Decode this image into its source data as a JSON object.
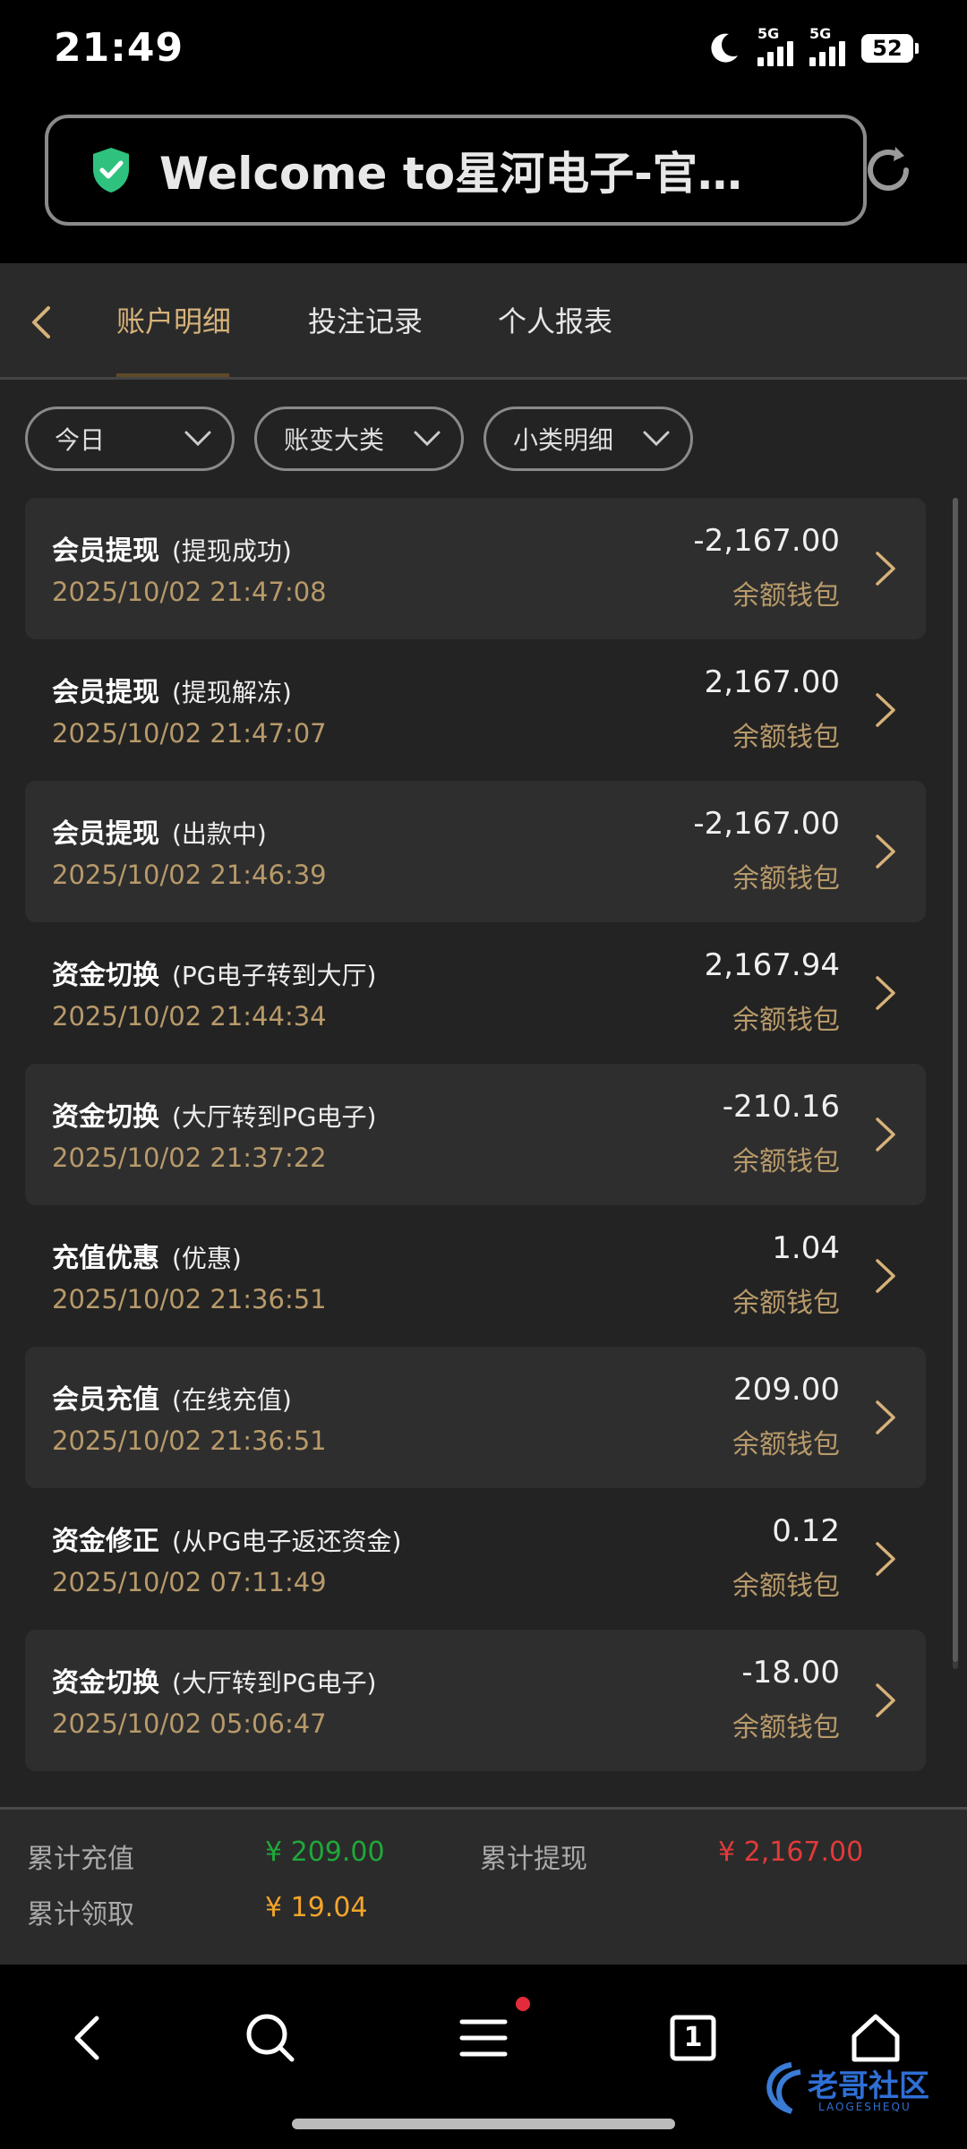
{
  "status_bar": {
    "time": "21:49",
    "network1": "5G",
    "network2": "5G",
    "battery": "52"
  },
  "browser": {
    "url_title": "Welcome to星河电子-官方…",
    "shield_color": "#2ec27e"
  },
  "tabs": [
    {
      "label": "账户明细",
      "active": true
    },
    {
      "label": "投注记录",
      "active": false
    },
    {
      "label": "个人报表",
      "active": false
    }
  ],
  "filters": [
    {
      "label": "今日"
    },
    {
      "label": "账变大类"
    },
    {
      "label": "小类明细"
    }
  ],
  "transactions": [
    {
      "type": "会员提现",
      "detail": "(提现成功)",
      "date": "2025/10/02 21:47:08",
      "amount": "-2,167.00",
      "wallet": "余额钱包"
    },
    {
      "type": "会员提现",
      "detail": "(提现解冻)",
      "date": "2025/10/02 21:47:07",
      "amount": "2,167.00",
      "wallet": "余额钱包"
    },
    {
      "type": "会员提现",
      "detail": "(出款中)",
      "date": "2025/10/02 21:46:39",
      "amount": "-2,167.00",
      "wallet": "余额钱包"
    },
    {
      "type": "资金切换",
      "detail": "(PG电子转到大厅)",
      "date": "2025/10/02 21:44:34",
      "amount": "2,167.94",
      "wallet": "余额钱包"
    },
    {
      "type": "资金切换",
      "detail": "(大厅转到PG电子)",
      "date": "2025/10/02 21:37:22",
      "amount": "-210.16",
      "wallet": "余额钱包"
    },
    {
      "type": "充值优惠",
      "detail": "(优惠)",
      "date": "2025/10/02 21:36:51",
      "amount": "1.04",
      "wallet": "余额钱包"
    },
    {
      "type": "会员充值",
      "detail": "(在线充值)",
      "date": "2025/10/02 21:36:51",
      "amount": "209.00",
      "wallet": "余额钱包"
    },
    {
      "type": "资金修正",
      "detail": "(从PG电子返还资金)",
      "date": "2025/10/02 07:11:49",
      "amount": "0.12",
      "wallet": "余额钱包"
    },
    {
      "type": "资金切换",
      "detail": "(大厅转到PG电子)",
      "date": "2025/10/02 05:06:47",
      "amount": "-18.00",
      "wallet": "余额钱包"
    }
  ],
  "summary": {
    "total_recharge_label": "累计充值",
    "total_recharge_value": "¥ 209.00",
    "total_withdraw_label": "累计提现",
    "total_withdraw_value": "¥ 2,167.00",
    "total_claimed_label": "累计领取",
    "total_claimed_value": "¥ 19.04"
  },
  "bottom_nav": {
    "tab_count": "1"
  },
  "watermark": {
    "text": "老哥社区",
    "subtext": "LAOGESHEQU"
  },
  "colors": {
    "accent_gold": "#d6b27a",
    "date_gold": "#b89a6a",
    "green": "#1fa83a",
    "red": "#e23a3a",
    "orange": "#f2a52b"
  }
}
